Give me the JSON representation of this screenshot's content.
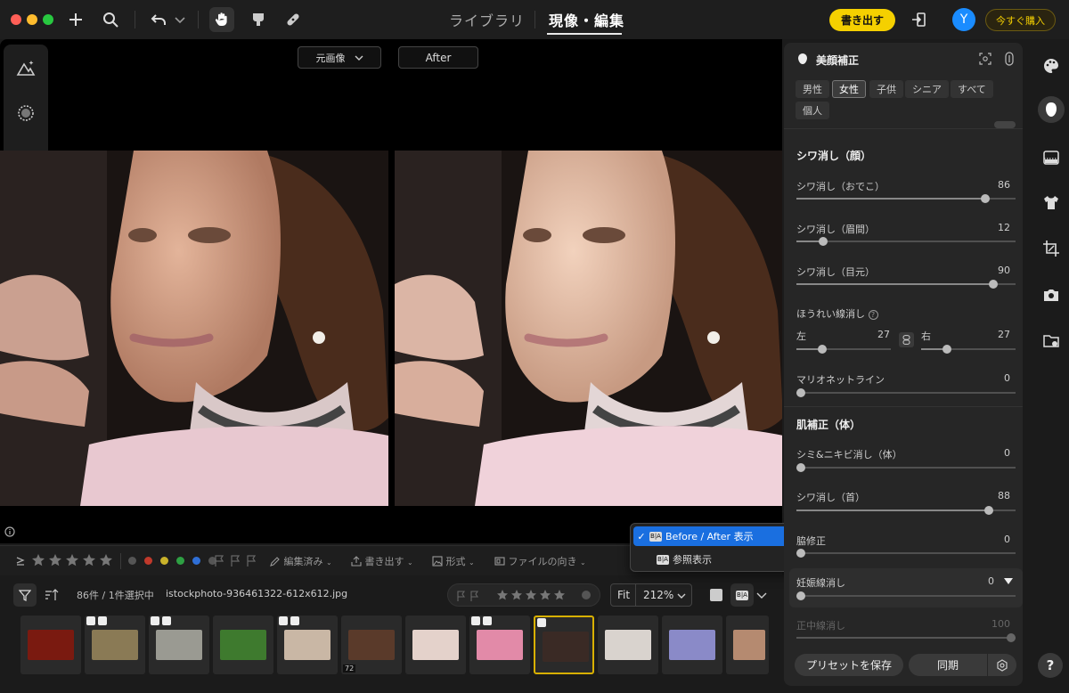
{
  "top": {
    "nav_library": "ライブラリ",
    "nav_develop": "現像・編集",
    "export_label": "書き出す",
    "avatar_letter": "Y",
    "buy_label": "今すぐ購入",
    "accent": "#f5d000"
  },
  "viewer": {
    "before_dropdown": "元画像",
    "after_label": "After"
  },
  "toolbar": {
    "edited": "編集済み",
    "export": "書き出す",
    "format": "形式",
    "orientation": "ファイルの向き",
    "label_colors": [
      "#555555",
      "#c0392b",
      "#c9b22a",
      "#2ea043",
      "#2f6fd6",
      "#555555"
    ]
  },
  "filmstrip": {
    "count": "86件 / 1件選択中",
    "filename": "istockphoto-936461322-612x612.jpg",
    "fit_label": "Fit",
    "zoom": "212%",
    "stack_count": "72",
    "thumbs": [
      {
        "color": "#7a1a10"
      },
      {
        "color": "#8a7a55"
      },
      {
        "color": "#9a9a92"
      },
      {
        "color": "#3e7a2e"
      },
      {
        "color": "#c9b7a5"
      },
      {
        "color": "#5a3a2a"
      },
      {
        "color": "#e4d2cb"
      },
      {
        "color": "#e28aa8"
      },
      {
        "color": "#3a2a25"
      },
      {
        "color": "#d9d3ce"
      },
      {
        "color": "#8a8ac8"
      },
      {
        "color": "#b58a70"
      }
    ]
  },
  "menu": {
    "item1": "Before / After 表示",
    "item2": "参照表示",
    "ba_badge": "B|A"
  },
  "panel": {
    "title": "美顔補正",
    "chips": [
      "男性",
      "女性",
      "子供",
      "シニア",
      "すべて",
      "個人"
    ],
    "section_face": "シワ消し（顔）",
    "forehead": {
      "label": "シワ消し（おでこ）",
      "value": 86
    },
    "glabella": {
      "label": "シワ消し（眉間）",
      "value": 12
    },
    "eyes": {
      "label": "シワ消し（目元）",
      "value": 90
    },
    "nasolabial": {
      "label": "ほうれい線消し",
      "left_label": "左",
      "left_value": 27,
      "right_label": "右",
      "right_value": 27
    },
    "marionette": {
      "label": "マリオネットライン",
      "value": 0
    },
    "section_body": "肌補正（体）",
    "body_spots": {
      "label": "シミ&ニキビ消し（体）",
      "value": 0
    },
    "neck": {
      "label": "シワ消し（首）",
      "value": 88
    },
    "armpit": {
      "label": "脇修正",
      "value": 0
    },
    "stretch": {
      "label": "妊娠線消し",
      "value": 0
    },
    "midline": {
      "label": "正中線消し",
      "value": 100
    },
    "preset_btn": "プリセットを保存",
    "sync_btn": "同期"
  },
  "help": "?"
}
